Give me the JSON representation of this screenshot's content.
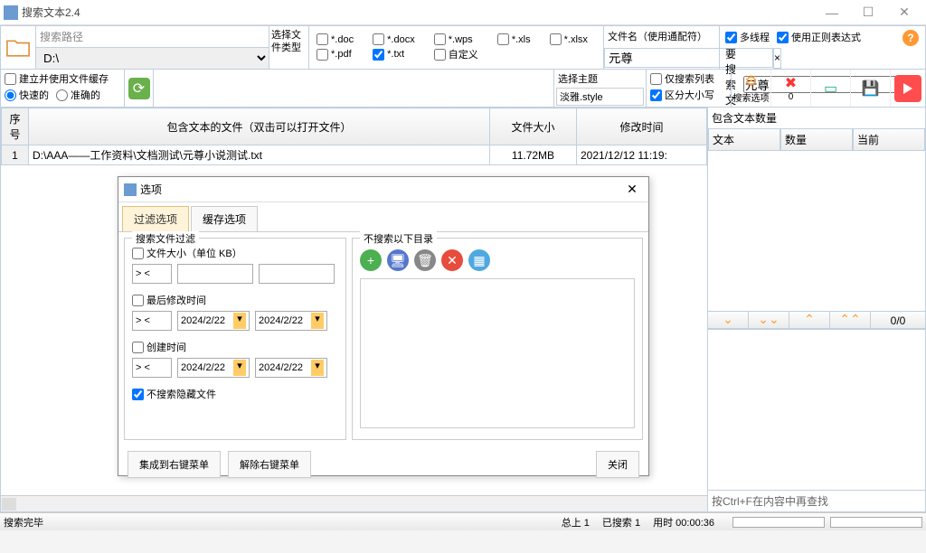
{
  "window": {
    "title": "搜索文本2.4"
  },
  "toolbar": {
    "path_label": "搜索路径",
    "path_value": "D:\\",
    "filetype_label": "选择文件类型",
    "filetypes": {
      "doc": "*.doc",
      "docx": "*.docx",
      "wps": "*.wps",
      "xls": "*.xls",
      "xlsx": "*.xlsx",
      "pdf": "*.pdf",
      "txt": "*.txt",
      "custom": "自定义"
    },
    "filename_label": "文件名（使用通配符）",
    "filename_value": "元尊",
    "multithread": "多线程",
    "use_regex": "使用正则表达式",
    "search_text_label": "要搜索文本",
    "search_text_value": "元尊"
  },
  "toolbar2": {
    "build_cache": "建立并使用文件缓存",
    "fast": "快速的",
    "accurate": "准确的",
    "theme_label": "选择主题",
    "theme_value": "淡雅.style",
    "only_list": "仅搜索列表",
    "case_sensitive": "区分大小写",
    "search_opts": "搜索选项",
    "count": "0"
  },
  "table": {
    "col_num": "序号",
    "col_file": "包含文本的文件（双击可以打开文件）",
    "col_size": "文件大小",
    "col_mtime": "修改时间",
    "rows": [
      {
        "n": "1",
        "file": "D:\\AAA——工作资料\\文档测试\\元尊小说测试.txt",
        "size": "11.72MB",
        "mtime": "2021/12/12 11:19:"
      }
    ]
  },
  "right": {
    "header": "包含文本数量",
    "col_text": "文本",
    "col_count": "数量",
    "col_curr": "当前",
    "nav_count": "0/0",
    "hint": "按Ctrl+F在内容中再查找"
  },
  "status": {
    "msg": "搜索完毕",
    "total_lbl": "总上",
    "total": "1",
    "searched_lbl": "已搜索",
    "searched": "1",
    "time_lbl": "用时",
    "time": "00:00:36"
  },
  "dialog": {
    "title": "选项",
    "tab_filter": "过滤选项",
    "tab_cache": "缓存选项",
    "fs_filter": "搜索文件过滤",
    "fs_exclude": "不搜索以下目录",
    "size_label": "文件大小（单位 KB）",
    "range_sym": "> <",
    "mtime_label": "最后修改时间",
    "ctime_label": "创建时间",
    "date_val": "2024/2/22",
    "hide_label": "不搜索隐藏文件",
    "btn_integrate": "集成到右键菜单",
    "btn_remove": "解除右键菜单",
    "btn_close": "关闭"
  }
}
